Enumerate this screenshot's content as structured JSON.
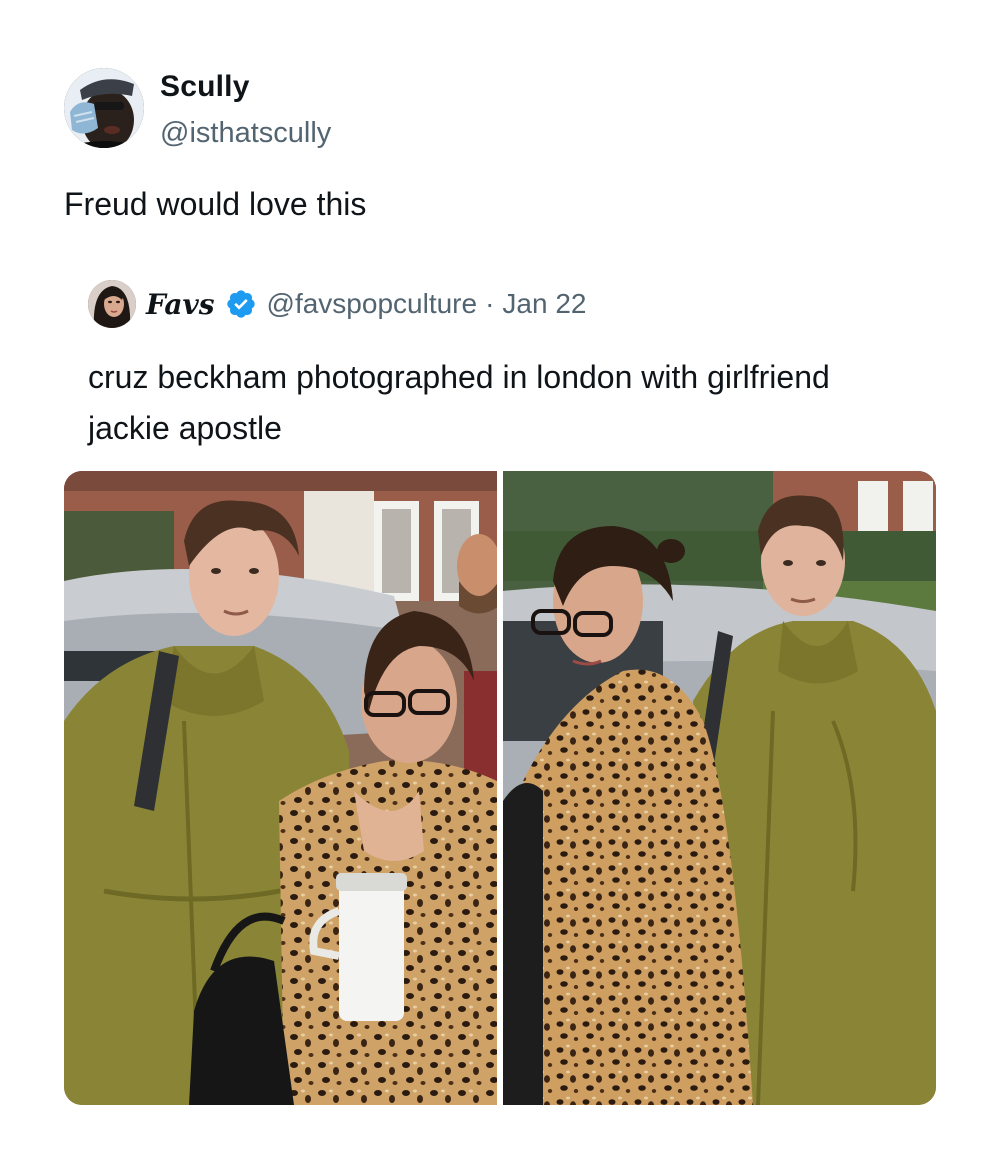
{
  "author": {
    "name": "Scully",
    "handle": "@isthatscully",
    "avatar_icon": "profile-photo"
  },
  "tweet": {
    "text": "Freud would love this"
  },
  "quoted": {
    "name": "Favs",
    "handle": "@favspopculture",
    "separator": "·",
    "date": "Jan 22",
    "verified": true,
    "verified_icon": "verified-badge-icon",
    "text": "cruz beckham photographed in london with girlfriend jackie apostle"
  },
  "media": {
    "count": 2,
    "photos": [
      "left-photo",
      "right-photo"
    ]
  },
  "colors": {
    "text": "#0f1419",
    "secondary": "#536471",
    "verified": "#1d9bf0",
    "background": "#ffffff"
  }
}
